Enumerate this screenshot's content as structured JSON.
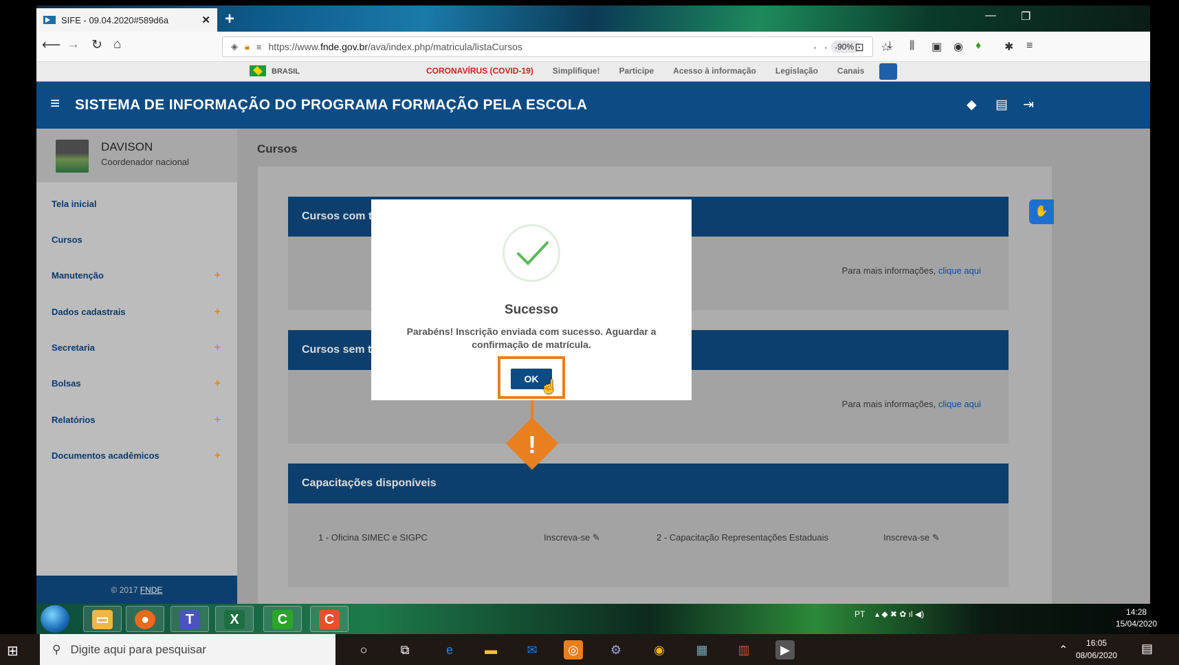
{
  "browser": {
    "tab_title": "SIFE - 09.04.2020#589d6a",
    "tab_close": "✕",
    "new_tab": "+",
    "url_prefix": "https://www.",
    "url_domain": "fnde.gov.br",
    "url_path": "/ava/index.php/matricula/listaCursos",
    "zoom": "90%"
  },
  "govbar": {
    "country": "BRASIL",
    "links": [
      "CORONAVÍRUS (COVID-19)",
      "Simplifique!",
      "Participe",
      "Acesso à informação",
      "Legislação",
      "Canais"
    ]
  },
  "header": {
    "title": "SISTEMA DE INFORMAÇÃO DO PROGRAMA FORMAÇÃO PELA ESCOLA"
  },
  "user": {
    "name": "DAVISON",
    "role": "Coordenador nacional"
  },
  "sidebar": {
    "items": [
      {
        "label": "Tela inicial",
        "expandable": false
      },
      {
        "label": "Cursos",
        "expandable": false
      },
      {
        "label": "Manutenção",
        "expandable": true
      },
      {
        "label": "Dados cadastrais",
        "expandable": true
      },
      {
        "label": "Secretaria",
        "expandable": true
      },
      {
        "label": "Bolsas",
        "expandable": true
      },
      {
        "label": "Relatórios",
        "expandable": true
      },
      {
        "label": "Documentos acadêmicos",
        "expandable": true
      }
    ],
    "plus": "+",
    "footer_prefix": "© 2017 ",
    "footer_link": "FNDE"
  },
  "content": {
    "breadcrumb": "Cursos",
    "cards": [
      {
        "title": "Cursos com tu",
        "info_prefix": "Para mais informações, ",
        "info_link": "clique aqui"
      },
      {
        "title": "Cursos sem tu",
        "info_prefix": "Para mais informações, ",
        "info_link": "clique aqui"
      },
      {
        "title": "Capacitações disponíveis"
      }
    ],
    "courses": [
      {
        "name": "1 - Oficina SIMEC e SIGPC",
        "action": "Inscreva-se"
      },
      {
        "name": "2 - Capacitação Representações Estaduais",
        "action": "Inscreva-se"
      }
    ]
  },
  "modal": {
    "title": "Sucesso",
    "message": "Parabéns! Inscrição enviada com sucesso. Aguardar a confirmação de matrícula.",
    "ok_label": "OK"
  },
  "annotation": {
    "symbol": "!"
  },
  "win7_taskbar": {
    "lang": "PT",
    "time": "14:28",
    "date": "15/04/2020"
  },
  "win10_taskbar": {
    "search_placeholder": "Digite aqui para pesquisar",
    "time": "16:05",
    "date": "08/06/2020"
  },
  "colors": {
    "header_blue": "#0c4b83",
    "annotation_orange": "#e8801f",
    "covid_red": "#cc2222",
    "success_green": "#5cb85c"
  }
}
